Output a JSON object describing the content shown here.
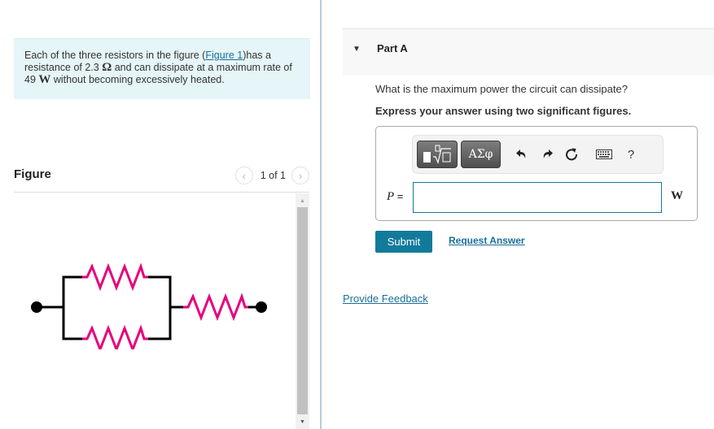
{
  "problem": {
    "text_before_link": "Each of the three resistors in the figure (",
    "link_label": "Figure 1",
    "text_after_link": ")has a resistance of 2.3 ",
    "resistance_unit": "Ω",
    "text_middle": " and can dissipate at a maximum rate of 49 ",
    "power_unit": "W",
    "text_end": " without becoming excessively heated."
  },
  "figure": {
    "title": "Figure",
    "pager_text": "1 of 1",
    "prev_icon": "chevron-left-icon",
    "next_icon": "chevron-right-icon",
    "circuit_description": "Two resistors in parallel, in series with a third resistor",
    "colors": {
      "resistor": "#e6007e",
      "wire": "#000000"
    }
  },
  "part": {
    "title": "Part A",
    "question": "What is the maximum power the circuit can dissipate?",
    "instruction": "Express your answer using two significant figures."
  },
  "toolbar": {
    "templates_icon": "templates-root-icon",
    "greek_label": "ΑΣφ",
    "undo_icon": "undo-icon",
    "redo_icon": "redo-icon",
    "reset_icon": "reset-icon",
    "keyboard_icon": "keyboard-icon",
    "help_label": "?"
  },
  "answer": {
    "variable": "P",
    "equals": " =",
    "value": "",
    "unit": "W"
  },
  "actions": {
    "submit_label": "Submit",
    "request_answer_label": "Request Answer",
    "feedback_label": "Provide Feedback"
  },
  "colors": {
    "accent": "#127b9b",
    "link": "#1a6e9a",
    "problem_bg": "#e6f5f7",
    "divider": "#b7ccdb"
  }
}
